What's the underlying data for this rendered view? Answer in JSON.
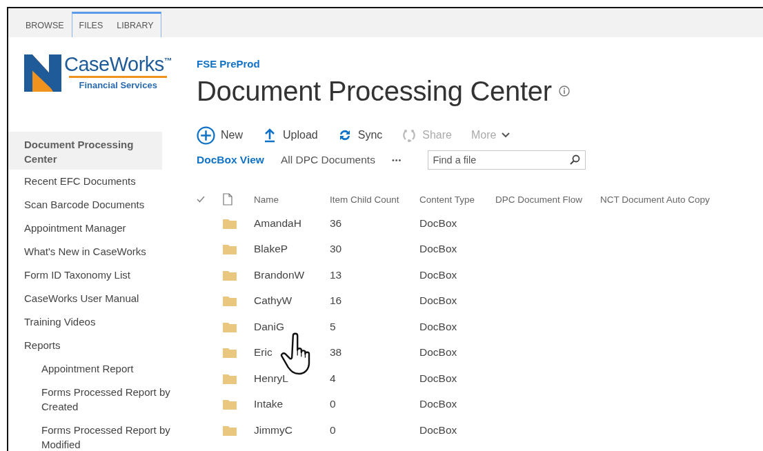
{
  "ribbon": {
    "tabs": [
      {
        "label": "BROWSE",
        "contextual": false,
        "selected": false
      },
      {
        "label": "FILES",
        "contextual": true,
        "selected": false
      },
      {
        "label": "LIBRARY",
        "contextual": true,
        "selected": false
      }
    ]
  },
  "logo": {
    "name": "CaseWorks",
    "mark": "™",
    "tagline": "Financial Services"
  },
  "site": {
    "name": "FSE PreProd",
    "title": "Document Processing Center"
  },
  "sidebar": {
    "items": [
      {
        "label": "Document Processing Center",
        "selected": true
      },
      {
        "label": "Recent EFC Documents",
        "selected": false
      },
      {
        "label": "Scan Barcode Documents",
        "selected": false
      },
      {
        "label": "Appointment Manager",
        "selected": false
      },
      {
        "label": "What's New in CaseWorks",
        "selected": false
      },
      {
        "label": "Form ID Taxonomy List",
        "selected": false
      },
      {
        "label": "CaseWorks User Manual",
        "selected": false
      },
      {
        "label": "Training Videos",
        "selected": false
      },
      {
        "label": "Reports",
        "selected": false,
        "children": [
          {
            "label": "Appointment Report",
            "selected": false
          },
          {
            "label": "Forms Processed Report by Created",
            "selected": false
          },
          {
            "label": "Forms Processed Report by Modified",
            "selected": false
          }
        ]
      }
    ]
  },
  "toolbar": [
    {
      "kind": "new",
      "label": "New",
      "disabled": false
    },
    {
      "kind": "upload",
      "label": "Upload",
      "disabled": false
    },
    {
      "kind": "sync",
      "label": "Sync",
      "disabled": false
    },
    {
      "kind": "share",
      "label": "Share",
      "disabled": true
    },
    {
      "kind": "more",
      "label": "More",
      "disabled": true
    }
  ],
  "views": [
    {
      "label": "DocBox View",
      "selected": true
    },
    {
      "label": "All DPC Documents",
      "selected": false
    }
  ],
  "views_more": "•••",
  "search": {
    "placeholder": "Find a file"
  },
  "table": {
    "columns": [
      "Name",
      "Item Child Count",
      "Content Type",
      "DPC Document Flow",
      "NCT Document Auto Copy"
    ],
    "rows": [
      {
        "name": "AmandaH",
        "count": "36",
        "type": "DocBox"
      },
      {
        "name": "BlakeP",
        "count": "30",
        "type": "DocBox"
      },
      {
        "name": "BrandonW",
        "count": "13",
        "type": "DocBox"
      },
      {
        "name": "CathyW",
        "count": "16",
        "type": "DocBox"
      },
      {
        "name": "DaniG",
        "count": "5",
        "type": "DocBox"
      },
      {
        "name": "Eric",
        "count": "38",
        "type": "DocBox"
      },
      {
        "name": "HenryL",
        "count": "4",
        "type": "DocBox"
      },
      {
        "name": "Intake",
        "count": "0",
        "type": "DocBox"
      },
      {
        "name": "JimmyC",
        "count": "0",
        "type": "DocBox"
      }
    ]
  },
  "cursor": {
    "kind": "hand"
  }
}
